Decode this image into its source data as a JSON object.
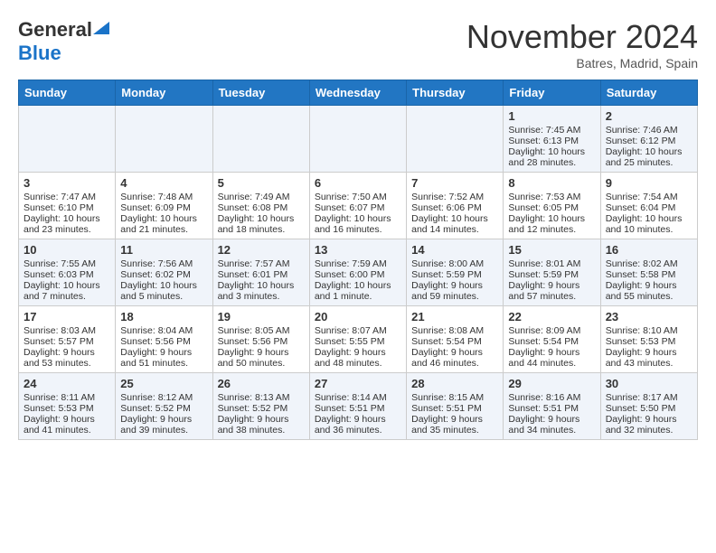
{
  "logo": {
    "general": "General",
    "blue": "Blue"
  },
  "title": "November 2024",
  "subtitle": "Batres, Madrid, Spain",
  "days_header": [
    "Sunday",
    "Monday",
    "Tuesday",
    "Wednesday",
    "Thursday",
    "Friday",
    "Saturday"
  ],
  "weeks": [
    [
      {
        "day": "",
        "info": ""
      },
      {
        "day": "",
        "info": ""
      },
      {
        "day": "",
        "info": ""
      },
      {
        "day": "",
        "info": ""
      },
      {
        "day": "",
        "info": ""
      },
      {
        "day": "1",
        "info": "Sunrise: 7:45 AM\nSunset: 6:13 PM\nDaylight: 10 hours\nand 28 minutes."
      },
      {
        "day": "2",
        "info": "Sunrise: 7:46 AM\nSunset: 6:12 PM\nDaylight: 10 hours\nand 25 minutes."
      }
    ],
    [
      {
        "day": "3",
        "info": "Sunrise: 7:47 AM\nSunset: 6:10 PM\nDaylight: 10 hours\nand 23 minutes."
      },
      {
        "day": "4",
        "info": "Sunrise: 7:48 AM\nSunset: 6:09 PM\nDaylight: 10 hours\nand 21 minutes."
      },
      {
        "day": "5",
        "info": "Sunrise: 7:49 AM\nSunset: 6:08 PM\nDaylight: 10 hours\nand 18 minutes."
      },
      {
        "day": "6",
        "info": "Sunrise: 7:50 AM\nSunset: 6:07 PM\nDaylight: 10 hours\nand 16 minutes."
      },
      {
        "day": "7",
        "info": "Sunrise: 7:52 AM\nSunset: 6:06 PM\nDaylight: 10 hours\nand 14 minutes."
      },
      {
        "day": "8",
        "info": "Sunrise: 7:53 AM\nSunset: 6:05 PM\nDaylight: 10 hours\nand 12 minutes."
      },
      {
        "day": "9",
        "info": "Sunrise: 7:54 AM\nSunset: 6:04 PM\nDaylight: 10 hours\nand 10 minutes."
      }
    ],
    [
      {
        "day": "10",
        "info": "Sunrise: 7:55 AM\nSunset: 6:03 PM\nDaylight: 10 hours\nand 7 minutes."
      },
      {
        "day": "11",
        "info": "Sunrise: 7:56 AM\nSunset: 6:02 PM\nDaylight: 10 hours\nand 5 minutes."
      },
      {
        "day": "12",
        "info": "Sunrise: 7:57 AM\nSunset: 6:01 PM\nDaylight: 10 hours\nand 3 minutes."
      },
      {
        "day": "13",
        "info": "Sunrise: 7:59 AM\nSunset: 6:00 PM\nDaylight: 10 hours\nand 1 minute."
      },
      {
        "day": "14",
        "info": "Sunrise: 8:00 AM\nSunset: 5:59 PM\nDaylight: 9 hours\nand 59 minutes."
      },
      {
        "day": "15",
        "info": "Sunrise: 8:01 AM\nSunset: 5:59 PM\nDaylight: 9 hours\nand 57 minutes."
      },
      {
        "day": "16",
        "info": "Sunrise: 8:02 AM\nSunset: 5:58 PM\nDaylight: 9 hours\nand 55 minutes."
      }
    ],
    [
      {
        "day": "17",
        "info": "Sunrise: 8:03 AM\nSunset: 5:57 PM\nDaylight: 9 hours\nand 53 minutes."
      },
      {
        "day": "18",
        "info": "Sunrise: 8:04 AM\nSunset: 5:56 PM\nDaylight: 9 hours\nand 51 minutes."
      },
      {
        "day": "19",
        "info": "Sunrise: 8:05 AM\nSunset: 5:56 PM\nDaylight: 9 hours\nand 50 minutes."
      },
      {
        "day": "20",
        "info": "Sunrise: 8:07 AM\nSunset: 5:55 PM\nDaylight: 9 hours\nand 48 minutes."
      },
      {
        "day": "21",
        "info": "Sunrise: 8:08 AM\nSunset: 5:54 PM\nDaylight: 9 hours\nand 46 minutes."
      },
      {
        "day": "22",
        "info": "Sunrise: 8:09 AM\nSunset: 5:54 PM\nDaylight: 9 hours\nand 44 minutes."
      },
      {
        "day": "23",
        "info": "Sunrise: 8:10 AM\nSunset: 5:53 PM\nDaylight: 9 hours\nand 43 minutes."
      }
    ],
    [
      {
        "day": "24",
        "info": "Sunrise: 8:11 AM\nSunset: 5:53 PM\nDaylight: 9 hours\nand 41 minutes."
      },
      {
        "day": "25",
        "info": "Sunrise: 8:12 AM\nSunset: 5:52 PM\nDaylight: 9 hours\nand 39 minutes."
      },
      {
        "day": "26",
        "info": "Sunrise: 8:13 AM\nSunset: 5:52 PM\nDaylight: 9 hours\nand 38 minutes."
      },
      {
        "day": "27",
        "info": "Sunrise: 8:14 AM\nSunset: 5:51 PM\nDaylight: 9 hours\nand 36 minutes."
      },
      {
        "day": "28",
        "info": "Sunrise: 8:15 AM\nSunset: 5:51 PM\nDaylight: 9 hours\nand 35 minutes."
      },
      {
        "day": "29",
        "info": "Sunrise: 8:16 AM\nSunset: 5:51 PM\nDaylight: 9 hours\nand 34 minutes."
      },
      {
        "day": "30",
        "info": "Sunrise: 8:17 AM\nSunset: 5:50 PM\nDaylight: 9 hours\nand 32 minutes."
      }
    ]
  ]
}
